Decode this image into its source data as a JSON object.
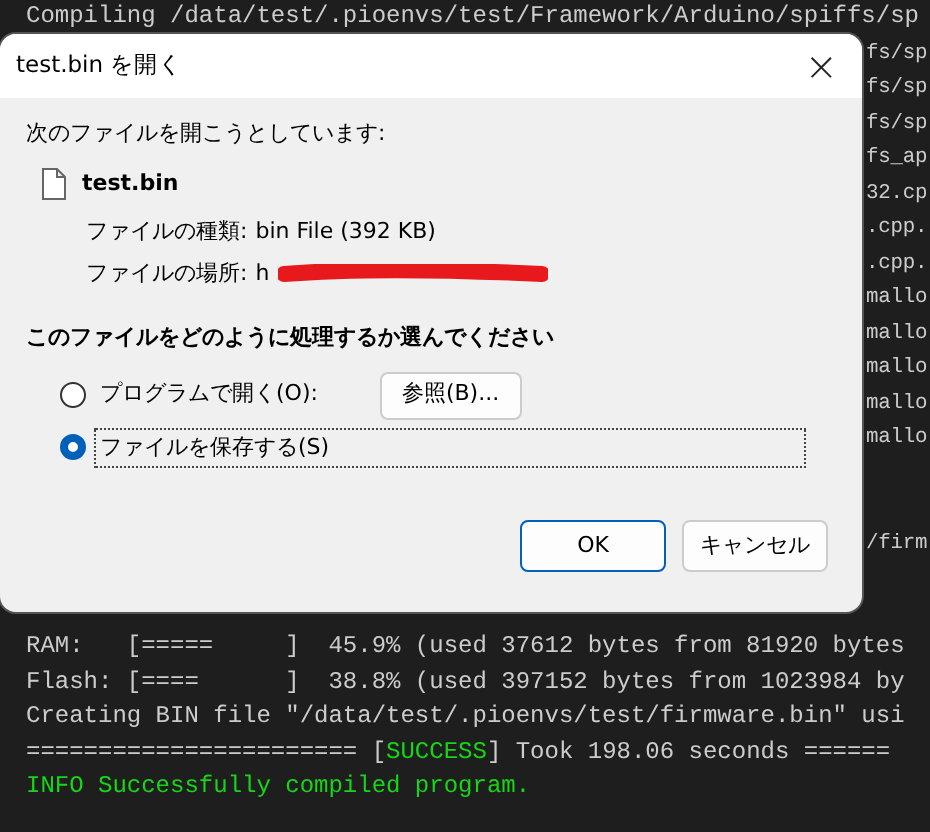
{
  "terminal": {
    "lines": [
      {
        "kind": "full",
        "text": "Compiling /data/test/.pioenvs/test/Framework/Arduino/spiffs/sp"
      },
      {
        "kind": "covered",
        "text": "fs/sp"
      },
      {
        "kind": "covered",
        "text": "fs/sp"
      },
      {
        "kind": "covered",
        "text": "fs/sp"
      },
      {
        "kind": "covered",
        "text": "fs_ap"
      },
      {
        "kind": "covered",
        "text": "32.cp"
      },
      {
        "kind": "covered",
        "text": ".cpp."
      },
      {
        "kind": "covered",
        "text": ".cpp."
      },
      {
        "kind": "covered",
        "text": "mallo"
      },
      {
        "kind": "covered",
        "text": "mallo"
      },
      {
        "kind": "covered",
        "text": "mallo"
      },
      {
        "kind": "covered",
        "text": "mallo"
      },
      {
        "kind": "covered",
        "text": "mallo"
      },
      {
        "kind": "blank"
      },
      {
        "kind": "blank"
      },
      {
        "kind": "covered",
        "text": "/firm"
      },
      {
        "kind": "blank"
      },
      {
        "kind": "blank"
      },
      {
        "kind": "full",
        "text": "RAM:   [=====     ]  45.9% (used 37612 bytes from 81920 bytes"
      },
      {
        "kind": "full",
        "text": "Flash: [====      ]  38.8% (used 397152 bytes from 1023984 by"
      },
      {
        "kind": "full",
        "text": "Creating BIN file \"/data/test/.pioenvs/test/firmware.bin\" usi"
      },
      {
        "kind": "status",
        "parts": [
          {
            "kind": "plain",
            "text": "======================= ["
          },
          {
            "kind": "success",
            "text": "SUCCESS"
          },
          {
            "kind": "plain",
            "text": "] Took 198.06 seconds ======"
          }
        ]
      },
      {
        "kind": "info",
        "text": "INFO Successfully compiled program."
      }
    ]
  },
  "dialog": {
    "title": "test.bin を開く",
    "close": "×",
    "intro": "次のファイルを開こうとしています:",
    "file_name": "test.bin",
    "details": [
      {
        "label": "ファイルの種類:",
        "value": "bin File (392 KB)",
        "redacted": false
      },
      {
        "label": "ファイルの場所:",
        "value": "h",
        "redacted": true
      }
    ],
    "question": "このファイルをどのように処理するか選んでください",
    "options": [
      {
        "label": "プログラムで開く(O):",
        "selected": false,
        "browse": "参照(B)..."
      },
      {
        "label": "ファイルを保存する(S)",
        "selected": true
      }
    ],
    "buttons": [
      {
        "label": "OK",
        "default": true
      },
      {
        "label": "キャンセル",
        "default": false
      }
    ]
  }
}
